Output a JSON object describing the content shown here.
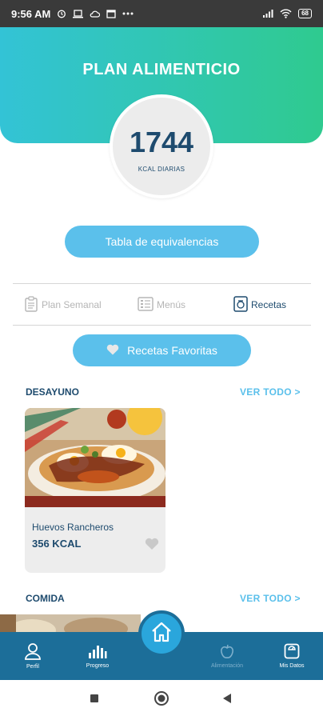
{
  "status_bar": {
    "time": "9:56 AM",
    "battery": "68",
    "icons": [
      "alarm-icon",
      "laptop-icon",
      "cloud-icon",
      "calendar-icon",
      "more-icon",
      "signal-icon",
      "wifi-icon",
      "battery-icon"
    ]
  },
  "header": {
    "title": "PLAN ALIMENTICIO",
    "kcal_value": "1744",
    "kcal_label": "KCAL DIARIAS",
    "gradient_start": "#33c3d6",
    "gradient_end": "#2fca8f"
  },
  "equivalencias_button": "Tabla de equivalencias",
  "tabs": [
    {
      "label": "Plan Semanal",
      "icon": "clipboard-icon",
      "active": false
    },
    {
      "label": "Menús",
      "icon": "list-icon",
      "active": false
    },
    {
      "label": "Recetas",
      "icon": "recipe-book-icon",
      "active": true
    }
  ],
  "favorites_button": "Recetas Favoritas",
  "sections": {
    "desayuno": {
      "title": "DESAYUNO",
      "see_all": "VER TODO >",
      "recipes": [
        {
          "name": "Huevos Rancheros",
          "kcal": "356 KCAL",
          "favorite": false
        }
      ]
    },
    "comida": {
      "title": "COMIDA",
      "see_all": "VER TODO >"
    }
  },
  "bottom_nav": {
    "items": [
      {
        "label": "Perfil",
        "icon": "user-icon"
      },
      {
        "label": "Progreso",
        "icon": "bar-chart-icon"
      },
      {
        "label": "Alimentación",
        "icon": "apple-icon"
      },
      {
        "label": "Mis Datos",
        "icon": "scale-icon"
      }
    ],
    "center_icon": "home-icon"
  },
  "colors": {
    "accent": "#5bc0eb",
    "primary_text": "#1e4b6e",
    "nav_bg": "#1c6e99"
  }
}
